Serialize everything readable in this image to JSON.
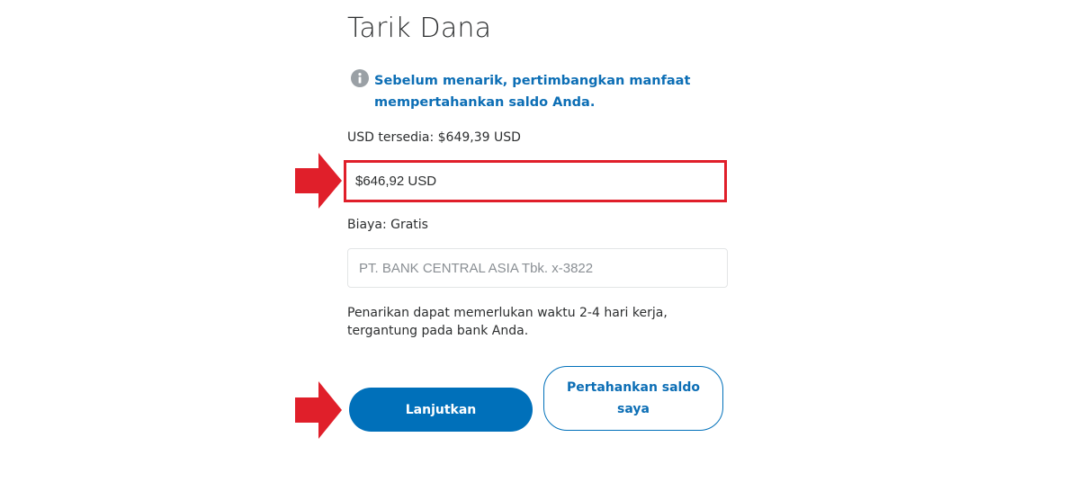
{
  "page": {
    "title": "Tarik Dana"
  },
  "info": {
    "icon": "info-icon",
    "text": "Sebelum menarik, pertimbangkan manfaat mempertahankan saldo Anda."
  },
  "balance": {
    "available_text": "USD tersedia: $649,39 USD"
  },
  "amount": {
    "value": "$646,92 USD"
  },
  "fee": {
    "text": "Biaya: Gratis"
  },
  "bank": {
    "value": "PT. BANK CENTRAL ASIA Tbk. x-3822"
  },
  "note": {
    "line1": "Penarikan dapat memerlukan waktu 2-4 hari kerja,",
    "line2": "tergantung pada bank Anda."
  },
  "buttons": {
    "continue_label": "Lanjutkan",
    "keep_balance_label": "Pertahankan saldo saya"
  },
  "colors": {
    "accent": "#0070ba",
    "link": "#0c6eb5",
    "highlight": "#e01f2a",
    "text": "#2c2e2f"
  }
}
